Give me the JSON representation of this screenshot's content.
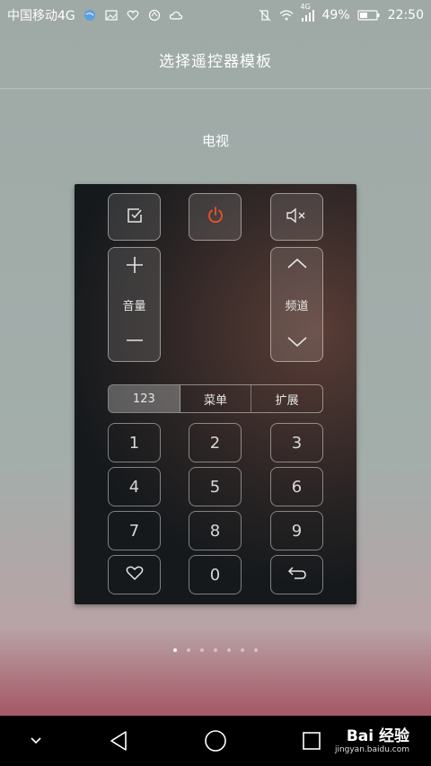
{
  "status": {
    "carrier": "中国移动4G",
    "network": "4G",
    "battery": "49%",
    "time": "22:50"
  },
  "header": {
    "title": "选择遥控器模板"
  },
  "device": {
    "label": "电视"
  },
  "remote": {
    "volume_label": "音量",
    "channel_label": "频道",
    "tabs": [
      "123",
      "菜单",
      "扩展"
    ],
    "keys": [
      "1",
      "2",
      "3",
      "4",
      "5",
      "6",
      "7",
      "8",
      "9",
      "0"
    ]
  },
  "pager": {
    "count": 7,
    "active": 0
  },
  "watermark": {
    "brand": "Bai 经验",
    "url": "jingyan.baidu.com"
  },
  "colors": {
    "power_icon": "#e8542a",
    "accent_bottom": "#8c3f4e"
  }
}
